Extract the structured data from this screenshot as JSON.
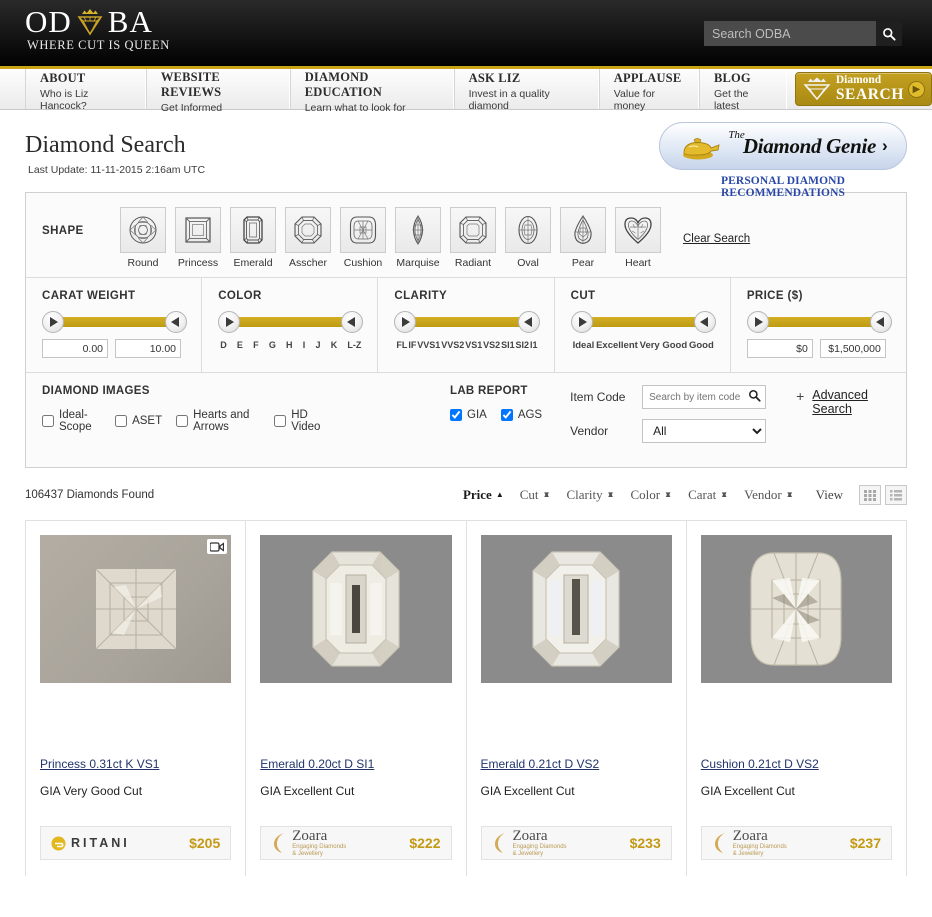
{
  "header": {
    "logo_main_left": "OD",
    "logo_main_right": "BA",
    "logo_sub": "WHERE CUT IS QUEEN",
    "search_placeholder": "Search ODBA",
    "search_value": "",
    "search_icon": "search-icon"
  },
  "nav": {
    "items": [
      {
        "title": "ABOUT",
        "sub": "Who is Liz Hancock?"
      },
      {
        "title": "WEBSITE REVIEWS",
        "sub": "Get Informed"
      },
      {
        "title": "DIAMOND EDUCATION",
        "sub": "Learn what to look for"
      },
      {
        "title": "ASK LIZ",
        "sub": "Invest in a quality diamond"
      },
      {
        "title": "APPLAUSE",
        "sub": "Value for money"
      },
      {
        "title": "BLOG",
        "sub": "Get the latest"
      }
    ],
    "cta_line1": "Diamond",
    "cta_line2": "SEARCH",
    "cta_arrow_icon": "chevron-right-icon"
  },
  "page": {
    "title": "Diamond Search",
    "last_update": "Last Update: 11-11-2015 2:16am UTC"
  },
  "genie": {
    "title": "Diamond Genie",
    "the": "The",
    "chevron": "›",
    "subtitle": "PERSONAL DIAMOND RECOMMENDATIONS",
    "lamp_icon": "magic-lamp-icon"
  },
  "filters": {
    "shape_label": "SHAPE",
    "clear_search": "Clear Search",
    "shapes": [
      {
        "name": "Round",
        "icon": "diamond-round-icon"
      },
      {
        "name": "Princess",
        "icon": "diamond-princess-icon"
      },
      {
        "name": "Emerald",
        "icon": "diamond-emerald-icon"
      },
      {
        "name": "Asscher",
        "icon": "diamond-asscher-icon"
      },
      {
        "name": "Cushion",
        "icon": "diamond-cushion-icon"
      },
      {
        "name": "Marquise",
        "icon": "diamond-marquise-icon"
      },
      {
        "name": "Radiant",
        "icon": "diamond-radiant-icon"
      },
      {
        "name": "Oval",
        "icon": "diamond-oval-icon"
      },
      {
        "name": "Pear",
        "icon": "diamond-pear-icon"
      },
      {
        "name": "Heart",
        "icon": "diamond-heart-icon"
      }
    ],
    "carat": {
      "title": "CARAT WEIGHT",
      "min_value": "0.00",
      "max_value": "10.00"
    },
    "color": {
      "title": "COLOR",
      "ticks": [
        "D",
        "E",
        "F",
        "G",
        "H",
        "I",
        "J",
        "K",
        "L-Z"
      ]
    },
    "clarity": {
      "title": "CLARITY",
      "ticks": [
        "FL",
        "IF",
        "VVS1",
        "VVS2",
        "VS1",
        "VS2",
        "SI1",
        "SI2",
        "I1"
      ]
    },
    "cut": {
      "title": "CUT",
      "ticks": [
        "Ideal",
        "Excellent",
        "Very Good",
        "Good"
      ]
    },
    "price": {
      "title": "PRICE ($)",
      "min_value": "$0",
      "max_value": "$1,500,000"
    },
    "images": {
      "title": "DIAMOND IMAGES",
      "options": [
        {
          "label": "Ideal-Scope",
          "checked": false
        },
        {
          "label": "ASET",
          "checked": false
        },
        {
          "label": "Hearts and Arrows",
          "checked": false
        },
        {
          "label": "HD Video",
          "checked": false
        }
      ]
    },
    "lab_report": {
      "title": "LAB REPORT",
      "options": [
        {
          "label": "GIA",
          "checked": true
        },
        {
          "label": "AGS",
          "checked": true
        }
      ]
    },
    "item_code": {
      "label": "Item Code",
      "placeholder": "Search by item code...",
      "value": "",
      "icon": "search-icon"
    },
    "vendor": {
      "label": "Vendor",
      "selected": "All",
      "options": [
        "All"
      ]
    },
    "advanced": {
      "plus": "+",
      "label": "Advanced Search"
    }
  },
  "results": {
    "count_text": "106437 Diamonds Found",
    "sorts": [
      {
        "label": "Price",
        "state": "asc",
        "active": true
      },
      {
        "label": "Cut",
        "state": "none",
        "active": false
      },
      {
        "label": "Clarity",
        "state": "none",
        "active": false
      },
      {
        "label": "Color",
        "state": "none",
        "active": false
      },
      {
        "label": "Carat",
        "state": "none",
        "active": false
      },
      {
        "label": "Vendor",
        "state": "none",
        "active": false
      }
    ],
    "view_label": "View",
    "view_modes": [
      {
        "icon": "grid-view-icon",
        "active": true
      },
      {
        "icon": "list-view-icon",
        "active": false
      }
    ],
    "cards": [
      {
        "title": "Princess 0.31ct K VS1",
        "sub": "GIA Very Good Cut",
        "vendor": "RITANI",
        "vendor_key": "ritani",
        "price": "$205",
        "has_video_badge": true,
        "shape": "princess"
      },
      {
        "title": "Emerald 0.20ct D SI1",
        "sub": "GIA Excellent Cut",
        "vendor": "Zoara",
        "vendor_key": "zoara",
        "vendor_tagline1": "Engaging Diamonds",
        "vendor_tagline2": "& Jewellery",
        "price": "$222",
        "has_video_badge": false,
        "shape": "emerald"
      },
      {
        "title": "Emerald 0.21ct D VS2",
        "sub": "GIA Excellent Cut",
        "vendor": "Zoara",
        "vendor_key": "zoara",
        "vendor_tagline1": "Engaging Diamonds",
        "vendor_tagline2": "& Jewellery",
        "price": "$233",
        "has_video_badge": false,
        "shape": "emerald"
      },
      {
        "title": "Cushion 0.21ct D VS2",
        "sub": "GIA Excellent Cut",
        "vendor": "Zoara",
        "vendor_key": "zoara",
        "vendor_tagline1": "Engaging Diamonds",
        "vendor_tagline2": "& Jewellery",
        "price": "$237",
        "has_video_badge": false,
        "shape": "cushion"
      }
    ]
  },
  "colors": {
    "gold": "#c9a227",
    "gold_dark": "#a98a13",
    "header_black": "#111111",
    "link_blue": "#22356b",
    "genie_blue": "#2a48a8"
  }
}
